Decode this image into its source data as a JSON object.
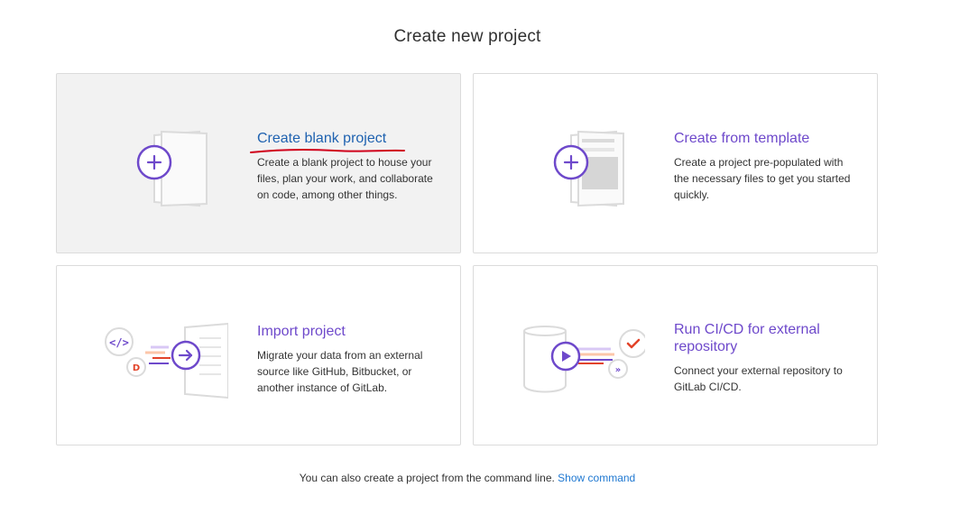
{
  "page": {
    "title": "Create new project"
  },
  "cards": [
    {
      "title": "Create blank project",
      "description": "Create a blank project to house your files, plan your work, and collaborate on code, among other things.",
      "icon": "blank-project-icon"
    },
    {
      "title": "Create from template",
      "description": "Create a project pre-populated with the necessary files to get you started quickly.",
      "icon": "template-project-icon"
    },
    {
      "title": "Import project",
      "description": "Migrate your data from an external source like GitHub, Bitbucket, or another instance of GitLab.",
      "icon": "import-project-icon"
    },
    {
      "title": "Run CI/CD for external repository",
      "description": "Connect your external repository to GitLab CI/CD.",
      "icon": "ci-cd-project-icon"
    }
  ],
  "footer": {
    "text": "You can also create a project from the command line.",
    "link_label": "Show command"
  },
  "colors": {
    "accent_purple": "#6e49cb",
    "link_blue": "#1f62b0",
    "annotation_red": "#d0021b",
    "orange": "#e24329"
  }
}
